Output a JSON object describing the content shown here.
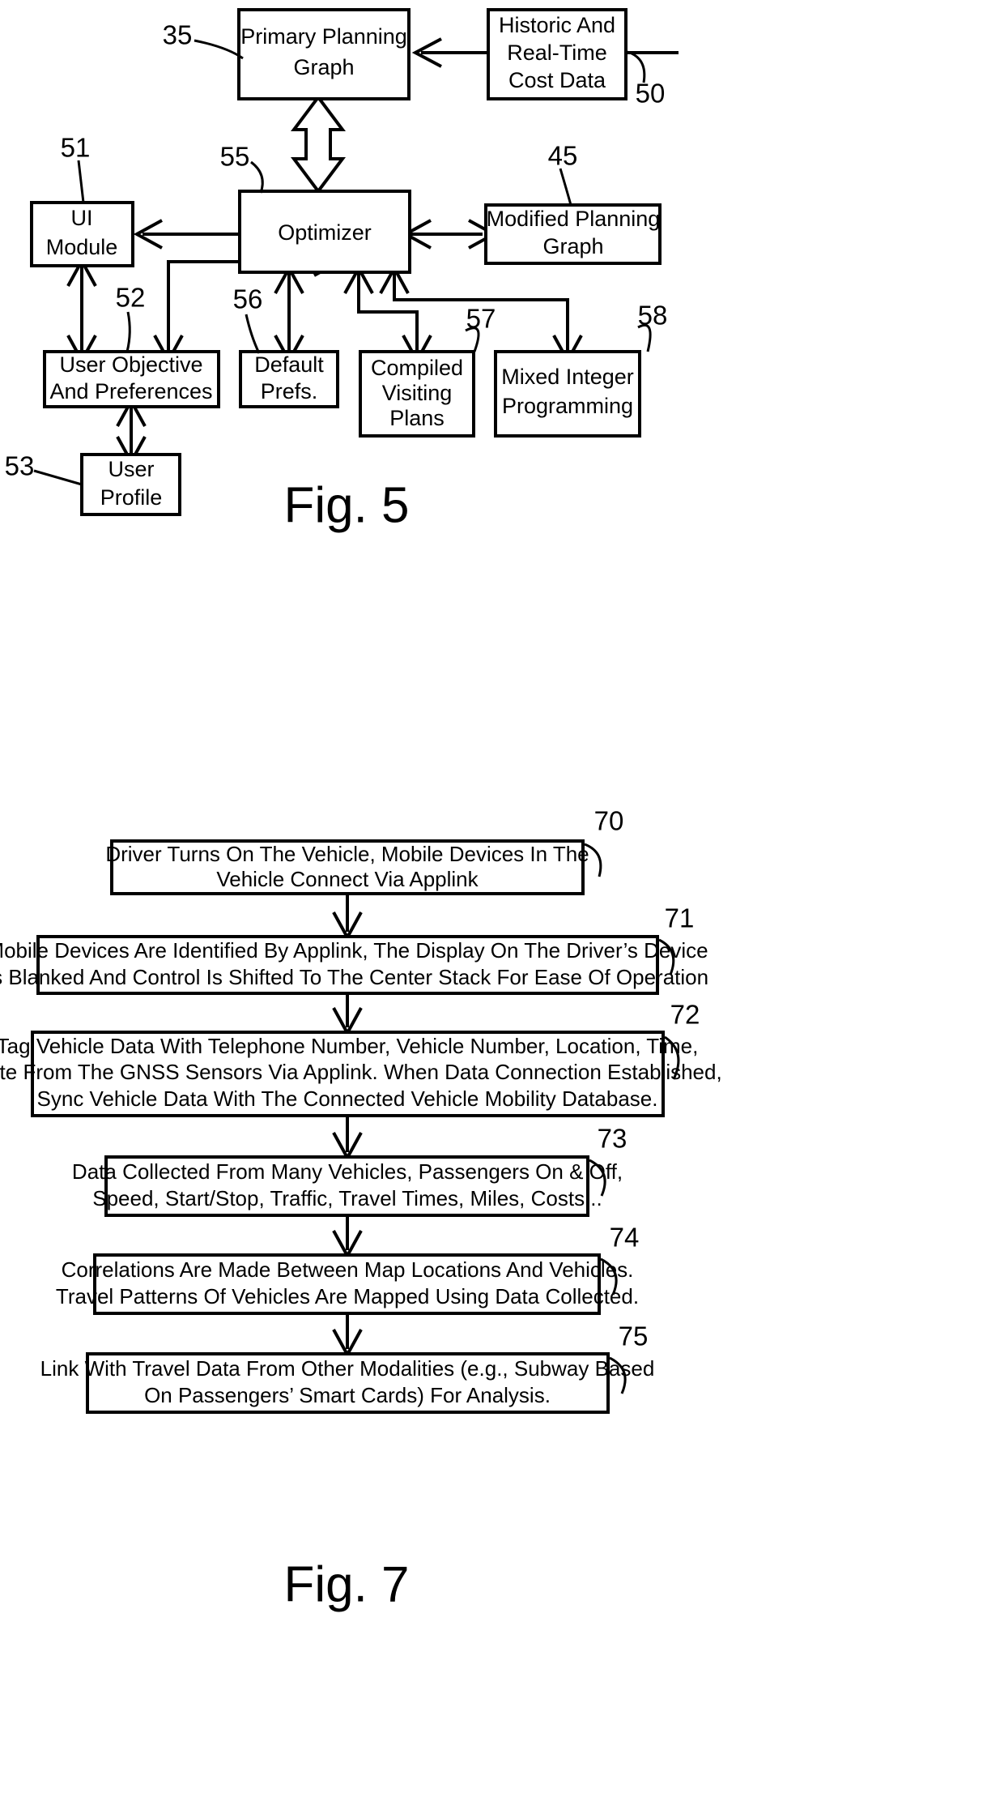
{
  "document": {
    "type": "patent-drawing-sheet",
    "figures": [
      "Fig. 5",
      "Fig. 7"
    ]
  },
  "fig5": {
    "caption": "Fig. 5",
    "boxes": [
      {
        "id": "primary-planning-graph",
        "ref": "35",
        "lines": [
          "Primary Planning",
          "Graph"
        ]
      },
      {
        "id": "historic-cost-data",
        "ref": "50",
        "lines": [
          "Historic And",
          "Real-Time",
          "Cost Data"
        ]
      },
      {
        "id": "ui-module",
        "ref": "51",
        "lines": [
          "UI",
          "Module"
        ]
      },
      {
        "id": "optimizer",
        "ref": "55",
        "lines": [
          "Optimizer"
        ]
      },
      {
        "id": "modified-planning-graph",
        "ref": "45",
        "lines": [
          "Modified Planning",
          "Graph"
        ]
      },
      {
        "id": "user-objective-and-preferences",
        "ref": "52",
        "lines": [
          "User Objective",
          "And Preferences"
        ]
      },
      {
        "id": "default-prefs",
        "ref": "56",
        "lines": [
          "Default",
          "Prefs."
        ]
      },
      {
        "id": "compiled-visiting-plans",
        "ref": "57",
        "lines": [
          "Compiled",
          "Visiting",
          "Plans"
        ]
      },
      {
        "id": "mixed-integer-programming",
        "ref": "58",
        "lines": [
          "Mixed Integer",
          "Programming"
        ]
      },
      {
        "id": "user-profile",
        "ref": "53",
        "lines": [
          "User",
          "Profile"
        ]
      }
    ],
    "ref_numbers": [
      "35",
      "50",
      "51",
      "55",
      "45",
      "52",
      "56",
      "57",
      "58",
      "53"
    ]
  },
  "fig7": {
    "caption": "Fig. 7",
    "steps": [
      {
        "ref": "70",
        "lines": [
          "Driver Turns On The Vehicle, Mobile Devices In The",
          "Vehicle Connect Via Applink"
        ]
      },
      {
        "ref": "71",
        "lines": [
          "Mobile Devices Are Identified By Applink, The Display On The Driver’s Device",
          "Is Blanked And Control Is Shifted To The Center Stack For Ease Of Operation"
        ]
      },
      {
        "ref": "72",
        "lines": [
          "Tag Vehicle Data With Telephone Number, Vehicle Number, Location, Time,",
          "Date From The GNSS Sensors Via Applink. When Data Connection Established,",
          "Sync Vehicle Data With The Connected Vehicle Mobility Database."
        ]
      },
      {
        "ref": "73",
        "lines": [
          "Data Collected From Many Vehicles, Passengers On & Off,",
          "Speed, Start/Stop, Traffic, Travel Times, Miles, Costs..."
        ]
      },
      {
        "ref": "74",
        "lines": [
          "Correlations Are Made Between Map Locations And Vehicles.",
          "Travel Patterns Of Vehicles Are Mapped Using Data Collected."
        ]
      },
      {
        "ref": "75",
        "lines": [
          "Link With Travel Data From Other Modalities (e.g., Subway Based",
          "On Passengers’ Smart Cards) For Analysis."
        ]
      }
    ],
    "ref_numbers": [
      "70",
      "71",
      "72",
      "73",
      "74",
      "75"
    ]
  },
  "colors": {
    "ink": "#000000",
    "paper": "#ffffff"
  }
}
